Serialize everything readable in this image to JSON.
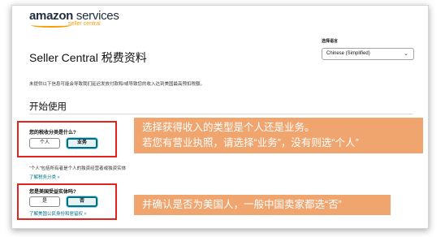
{
  "header": {
    "logo_main": "amazon",
    "logo_services": " services",
    "logo_sub": "seller central"
  },
  "language": {
    "label": "选择语言",
    "selected": "Chinese (Simplified)"
  },
  "page": {
    "title": "Seller Central 税费资料",
    "notice": "未提供以下信息可能会导致我们延迟发放付款和/或导致您的收入达到美国最高预扣税额。",
    "section_title": "开始使用"
  },
  "question1": {
    "label": "您的税收分类是什么?",
    "option_individual": "个人",
    "option_business": "业务",
    "hint": "“个人”包括所有者是个人的独资经营者或独资实体",
    "link": "了解税务分类  ˅"
  },
  "question2": {
    "label": "您是美国受益实体吗?",
    "option_yes": "是",
    "option_no": "否",
    "link": "了解美国公民身份和居留权  ˅"
  },
  "callouts": {
    "first_line1": "选择获得收入的类型是个人还是业务。",
    "first_line2": "若您有营业执照，请选择“业务”，没有则选“个人”",
    "second": "并确认是否为美国人，一般中国卖家都选“否”"
  },
  "colors": {
    "brand_orange": "#ff9900",
    "callout_bg": "#f0a46e",
    "highlight_red": "#e3231e",
    "selected_teal": "#007185"
  }
}
